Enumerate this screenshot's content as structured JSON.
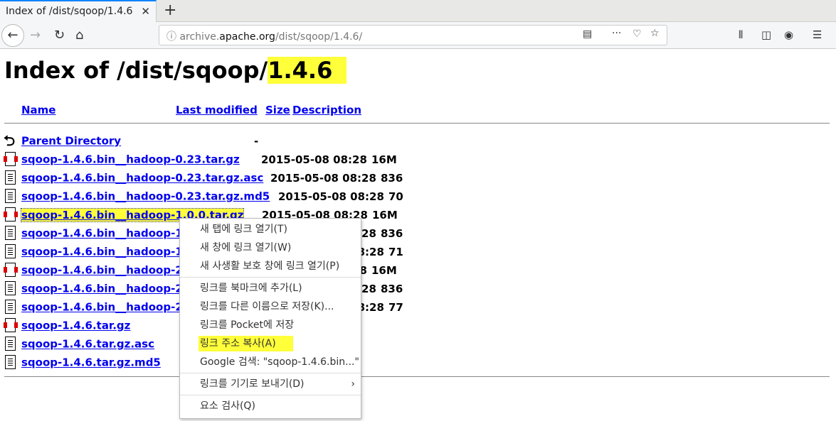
{
  "tab": {
    "title": "Index of /dist/sqoop/1.4.6"
  },
  "url": {
    "pre": "archive.",
    "domain": "apache.org",
    "path": "/dist/sqoop/1.4.6/"
  },
  "page": {
    "title_prefix": "Index of /dist/sqoop/",
    "title_version": "1.4.6"
  },
  "columns": {
    "name": "Name",
    "modified": "Last modified",
    "size": "Size",
    "description": "Description"
  },
  "parent": {
    "label": "Parent Directory",
    "size": "-"
  },
  "files": [
    {
      "name": "sqoop-1.4.6.bin__hadoop-0.23.tar.gz",
      "date": "2015-05-08 08:28",
      "size": "16M",
      "type": "bin"
    },
    {
      "name": "sqoop-1.4.6.bin__hadoop-0.23.tar.gz.asc",
      "date": "2015-05-08 08:28",
      "size": "836",
      "type": "text"
    },
    {
      "name": "sqoop-1.4.6.bin__hadoop-0.23.tar.gz.md5",
      "date": "2015-05-08 08:28",
      "size": "70",
      "type": "text"
    },
    {
      "name": "sqoop-1.4.6.bin__hadoop-1.0.0.tar.gz",
      "date": "2015-05-08 08:28",
      "size": "16M",
      "type": "bin"
    },
    {
      "name": "sqoop-1.4.6.bin__hadoop-1.0.0.tar.gz.asc",
      "date": "2015-05-08 08:28",
      "size": "836",
      "type": "text"
    },
    {
      "name": "sqoop-1.4.6.bin__hadoop-1.0.0.tar.gz.md5",
      "date": "2015-05-08 08:28",
      "size": "71",
      "type": "text"
    },
    {
      "name": "sqoop-1.4.6.bin__hadoop-2.0.4-alpha.tar.gz",
      "date": "2015-05-08 08:28",
      "size": "16M",
      "type": "bin"
    },
    {
      "name": "sqoop-1.4.6.bin__hadoop-2.0.4-alpha.tar.gz.asc",
      "date": "2015-05-08 08:28",
      "size": "836",
      "type": "text"
    },
    {
      "name": "sqoop-1.4.6.bin__hadoop-2.0.4-alpha.tar.gz.md5",
      "date": "2015-05-08 08:28",
      "size": "77",
      "type": "text"
    },
    {
      "name": "sqoop-1.4.6.tar.gz",
      "date": "",
      "size": "",
      "type": "bin"
    },
    {
      "name": "sqoop-1.4.6.tar.gz.asc",
      "date": "",
      "size": "",
      "type": "text"
    },
    {
      "name": "sqoop-1.4.6.tar.gz.md5",
      "date": "",
      "size": "",
      "type": "text"
    }
  ],
  "context_menu": [
    {
      "label": "새 탭에 링크 열기(T)"
    },
    {
      "label": "새 창에 링크 열기(W)"
    },
    {
      "label": "새 사생활 보호 창에 링크 열기(P)",
      "sep_after": true
    },
    {
      "label": "링크를 북마크에 추가(L)"
    },
    {
      "label": "링크를 다른 이름으로 저장(K)..."
    },
    {
      "label": "링크를 Pocket에 저장"
    },
    {
      "label": "링크 주소 복사(A)",
      "highlight": true
    },
    {
      "label": "Google 검색: \"sqoop-1.4.6.bin...\"",
      "sep_after": true
    },
    {
      "label": "링크를 기기로 보내기(D)",
      "submenu": true,
      "sep_after": true
    },
    {
      "label": "요소 검사(Q)"
    }
  ],
  "colors": {
    "highlight": "#ffff3a",
    "link": "#0000ee"
  }
}
